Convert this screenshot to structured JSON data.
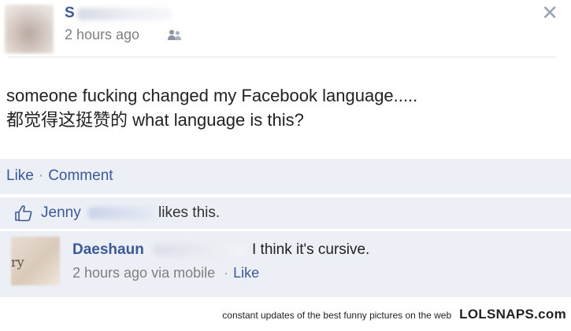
{
  "post": {
    "author": "S",
    "timestamp": "2 hours ago",
    "close_glyph": "✕",
    "text_line1": "someone fucking changed my Facebook language.....",
    "text_line2": "都觉得这挺赞的 what language is this?"
  },
  "actions": {
    "like": "Like",
    "separator": "·",
    "comment": "Comment"
  },
  "likes": {
    "liker": "Jenny",
    "suffix": "likes this."
  },
  "comment": {
    "author": "Daeshaun",
    "text": "I think it's cursive.",
    "avatar_mark": "ry",
    "time": "2 hours ago via mobile",
    "separator": "·",
    "like": "Like"
  },
  "footer": {
    "tagline": "constant updates of the best funny pictures on the web",
    "brand": "LOLSNAPS.com"
  },
  "colors": {
    "link": "#3b5998",
    "bar_bg": "#eceff5",
    "meta_text": "#7f7f7f"
  },
  "icons": {
    "audience": "friends-icon",
    "close": "close-icon",
    "like": "thumbs-up-icon"
  }
}
